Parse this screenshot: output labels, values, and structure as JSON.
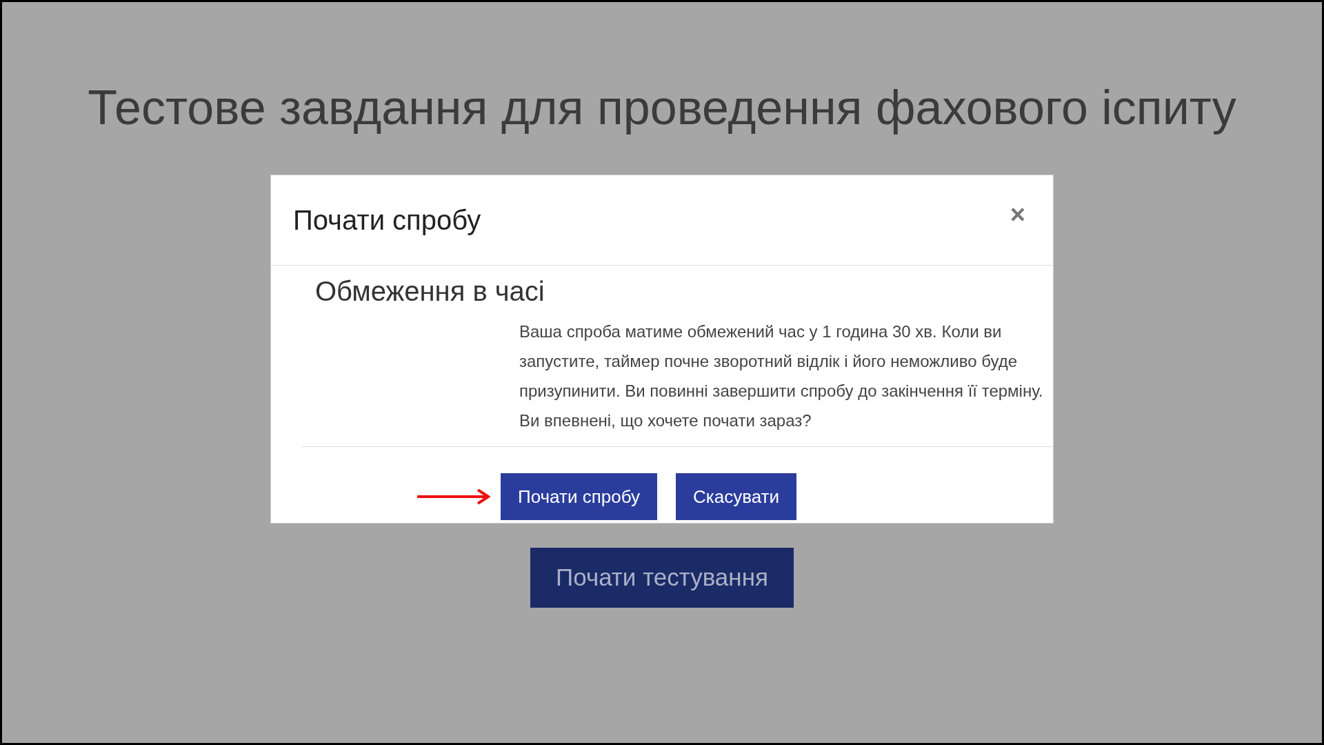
{
  "page": {
    "title": "Тестове завдання для проведення фахового іспиту"
  },
  "dialog": {
    "title": "Почати спробу",
    "close": "×",
    "section_title": "Обмеження в часі",
    "message": "Ваша спроба матиме обмежений час у 1 година 30 хв. Коли ви запустите, таймер почне зворотний відлік і його неможливо буде призупинити. Ви повинні завершити спробу до закінчення її терміну. Ви впевнені, що хочете почати зараз?",
    "buttons": [
      {
        "label": "Почати спробу"
      },
      {
        "label": "Скасувати"
      }
    ]
  },
  "start_button": {
    "label": "Почати тестування"
  }
}
